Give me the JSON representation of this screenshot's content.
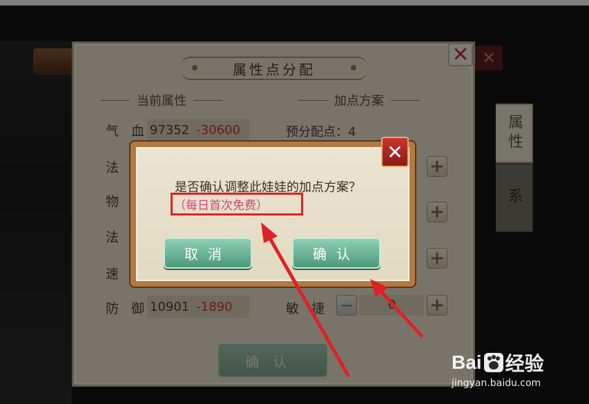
{
  "panel": {
    "title": "属性点分配",
    "close_glyph": "✕",
    "current_section": "当前属性",
    "plan_section": "加点方案",
    "preview_points": "预分配点：4",
    "rows": [
      {
        "label": "气 血",
        "value": "97352",
        "delta": "-30600"
      },
      {
        "label": "法",
        "value": "",
        "delta": ""
      },
      {
        "label": "物",
        "value": "",
        "delta": ""
      },
      {
        "label": "法",
        "value": "",
        "delta": ""
      },
      {
        "label": "速",
        "value": "",
        "delta": ""
      },
      {
        "label": "防 御",
        "value": "10901",
        "delta": "-1890"
      }
    ],
    "stat_label": "敏 捷",
    "stat_value": "0",
    "plus_glyph": "+",
    "minus_glyph": "−",
    "confirm_label": "确认"
  },
  "side_tabs": {
    "attributes": "属性",
    "faded": "系"
  },
  "dialog": {
    "question": "是否确认调整此娃娃的加点方案？",
    "free_note": "（每日首次免费）",
    "close_glyph": "✕",
    "cancel_label": "取消",
    "confirm_label": "确认"
  },
  "watermark": {
    "logo_left": "Bai",
    "logo_right": "经验",
    "url": "jingyan.baidu.com"
  },
  "colors": {
    "negative": "#c0353a",
    "highlight_box": "#e02027",
    "annotation_arrow": "#e02027",
    "dialog_button": "#5fae8c"
  }
}
